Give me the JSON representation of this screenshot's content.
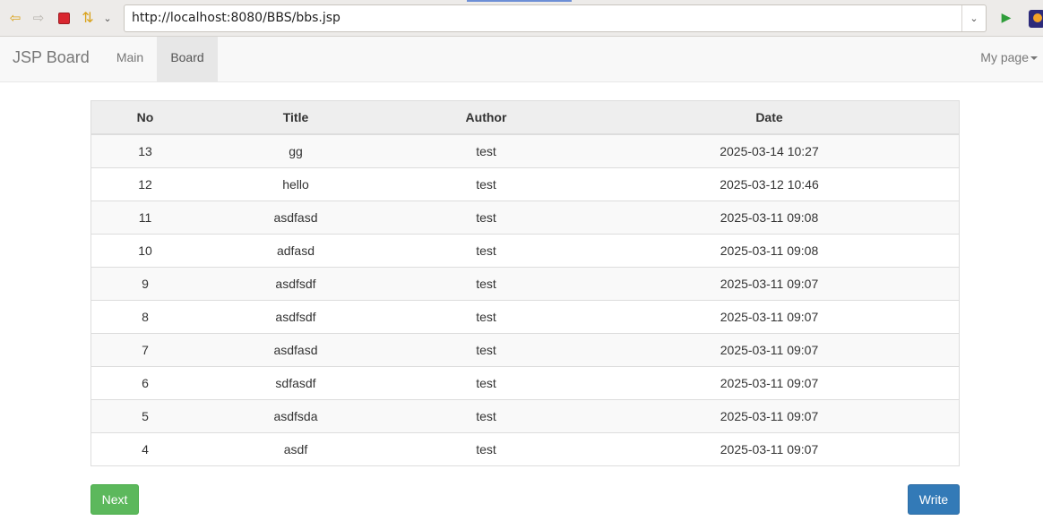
{
  "browser": {
    "url": "http://localhost:8080/BBS/bbs.jsp",
    "icons": [
      "back-icon",
      "forward-icon",
      "stop-icon",
      "refresh-icon",
      "history-dropdown-icon",
      "url-dropdown-icon",
      "go-icon",
      "eclipse-icon"
    ]
  },
  "navbar": {
    "brand": "JSP Board",
    "items": [
      {
        "label": "Main",
        "active": false
      },
      {
        "label": "Board",
        "active": true
      }
    ],
    "right_menu": "My page"
  },
  "table": {
    "headers": [
      "No",
      "Title",
      "Author",
      "Date"
    ],
    "rows": [
      {
        "no": "13",
        "title": "gg",
        "author": "test",
        "date": "2025-03-14 10:27"
      },
      {
        "no": "12",
        "title": "hello",
        "author": "test",
        "date": "2025-03-12 10:46"
      },
      {
        "no": "11",
        "title": "asdfasd",
        "author": "test",
        "date": "2025-03-11 09:08"
      },
      {
        "no": "10",
        "title": "adfasd",
        "author": "test",
        "date": "2025-03-11 09:08"
      },
      {
        "no": "9",
        "title": "asdfsdf",
        "author": "test",
        "date": "2025-03-11 09:07"
      },
      {
        "no": "8",
        "title": "asdfsdf",
        "author": "test",
        "date": "2025-03-11 09:07"
      },
      {
        "no": "7",
        "title": "asdfasd",
        "author": "test",
        "date": "2025-03-11 09:07"
      },
      {
        "no": "6",
        "title": "sdfasdf",
        "author": "test",
        "date": "2025-03-11 09:07"
      },
      {
        "no": "5",
        "title": "asdfsda",
        "author": "test",
        "date": "2025-03-11 09:07"
      },
      {
        "no": "4",
        "title": "asdf",
        "author": "test",
        "date": "2025-03-11 09:07"
      }
    ]
  },
  "buttons": {
    "next": "Next",
    "write": "Write"
  },
  "colors": {
    "next_button": "#5cb85c",
    "write_button": "#337ab7",
    "navbar_bg": "#f8f8f8",
    "active_nav_bg": "#e7e7e7"
  }
}
